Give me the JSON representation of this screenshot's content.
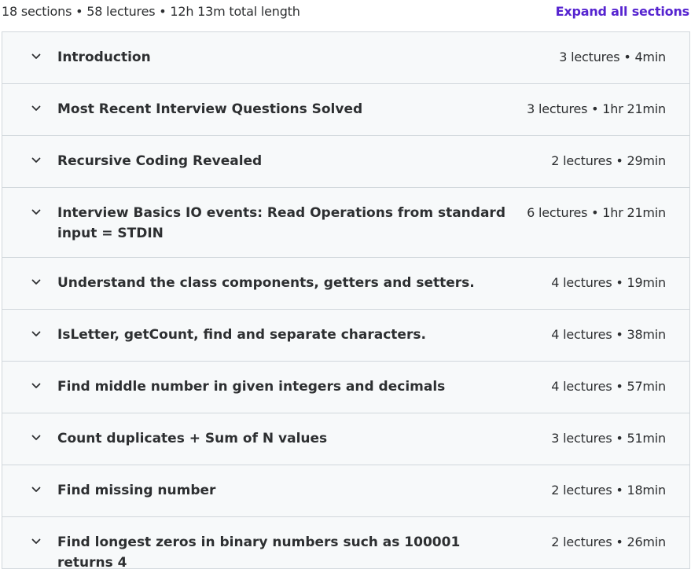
{
  "summary": {
    "text": "18 sections • 58 lectures • 12h 13m total length",
    "expand_label": "Expand all sections"
  },
  "colors": {
    "link": "#5624d0",
    "section_bg": "#f7f9fa",
    "border": "#d1d7dc",
    "text": "#2d2f31"
  },
  "sections": [
    {
      "title": "Introduction",
      "meta": "3 lectures • 4min",
      "icon": "chevron-down-icon"
    },
    {
      "title": "Most Recent Interview Questions Solved",
      "meta": "3 lectures • 1hr 21min",
      "icon": "chevron-down-icon"
    },
    {
      "title": "Recursive Coding Revealed",
      "meta": "2 lectures • 29min",
      "icon": "chevron-down-icon"
    },
    {
      "title": "Interview Basics IO events: Read Operations from standard input = STDIN",
      "meta": "6 lectures • 1hr 21min",
      "icon": "chevron-down-icon"
    },
    {
      "title": "Understand the class components, getters and setters.",
      "meta": "4 lectures • 19min",
      "icon": "chevron-down-icon"
    },
    {
      "title": "IsLetter, getCount, find and separate characters.",
      "meta": "4 lectures • 38min",
      "icon": "chevron-down-icon"
    },
    {
      "title": "Find middle number in given integers and decimals",
      "meta": "4 lectures • 57min",
      "icon": "chevron-down-icon"
    },
    {
      "title": "Count duplicates + Sum of N values",
      "meta": "3 lectures • 51min",
      "icon": "chevron-down-icon"
    },
    {
      "title": "Find missing number",
      "meta": "2 lectures • 18min",
      "icon": "chevron-down-icon"
    },
    {
      "title": "Find longest zeros in binary numbers such as 100001 returns 4",
      "meta": "2 lectures • 26min",
      "icon": "chevron-down-icon"
    }
  ]
}
